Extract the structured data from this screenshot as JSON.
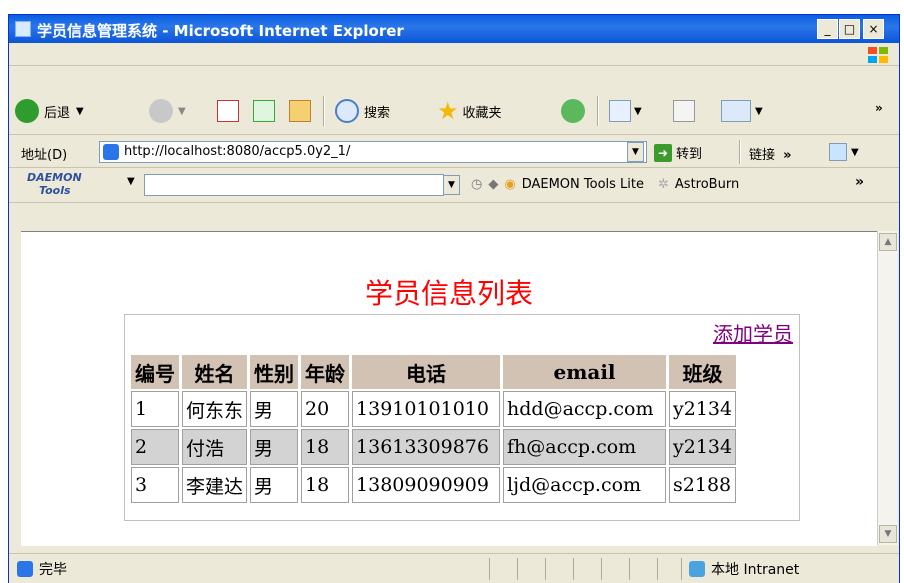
{
  "window": {
    "title": "学员信息管理系统 - Microsoft Internet Explorer"
  },
  "toolbar": {
    "back": "后退",
    "search": "搜索",
    "favorites": "收藏夹"
  },
  "address": {
    "label": "地址(D)",
    "url": "http://localhost:8080/accp5.0y2_1/",
    "go": "转到",
    "links": "链接"
  },
  "daemon": {
    "logo_line1": "DAEMON",
    "logo_line2": "Tools",
    "lite": "DAEMON Tools Lite",
    "astro": "AstroBurn"
  },
  "page": {
    "title": "学员信息列表",
    "add_link": "添加学员",
    "headers": [
      "编号",
      "姓名",
      "性别",
      "年龄",
      "电话",
      "email",
      "班级"
    ],
    "rows": [
      [
        "1",
        "何东东",
        "男",
        "20",
        "13910101010",
        "hdd@accp.com",
        "y2134"
      ],
      [
        "2",
        "付浩",
        "男",
        "18",
        "13613309876",
        "fh@accp.com",
        "y2134"
      ],
      [
        "3",
        "李建达",
        "男",
        "18",
        "13809090909",
        "ljd@accp.com",
        "s2188"
      ]
    ]
  },
  "status": {
    "left": "完毕",
    "zone": "本地 Intranet"
  }
}
